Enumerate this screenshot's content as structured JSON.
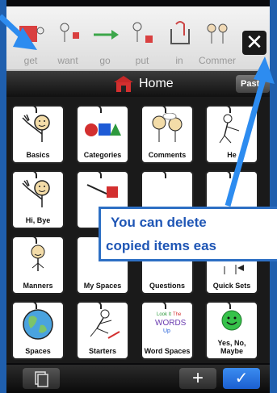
{
  "strip": {
    "items": [
      {
        "label": "get"
      },
      {
        "label": "want"
      },
      {
        "label": "go"
      },
      {
        "label": "put"
      },
      {
        "label": "in"
      },
      {
        "label": "Commer"
      }
    ],
    "close_label": "✕"
  },
  "titlebar": {
    "title": "Home",
    "paste_label": "Past"
  },
  "grid": {
    "cells": [
      {
        "label": "Basics"
      },
      {
        "label": "Categories"
      },
      {
        "label": "Comments"
      },
      {
        "label": "He"
      },
      {
        "label": "Hi, Bye"
      },
      {
        "label": ""
      },
      {
        "label": ""
      },
      {
        "label": ""
      },
      {
        "label": "Manners"
      },
      {
        "label": "My Spaces"
      },
      {
        "label": "Questions"
      },
      {
        "label": "Quick Sets"
      },
      {
        "label": "Spaces"
      },
      {
        "label": "Starters"
      },
      {
        "label": "Word Spaces"
      },
      {
        "label": "Yes, No, Maybe"
      }
    ],
    "word_icon_text": {
      "line1": "Look It",
      "line2": "The",
      "line3": "WORDS",
      "line4": "Up"
    }
  },
  "callout": {
    "line1": "You can delete",
    "line2": "copied items eas"
  },
  "bottombar": {
    "add_label": "+",
    "done_label": "✓"
  },
  "colors": {
    "accent_blue": "#2d8cf0",
    "callout_text": "#1f56b5",
    "done_button": "#1b5fd0"
  }
}
